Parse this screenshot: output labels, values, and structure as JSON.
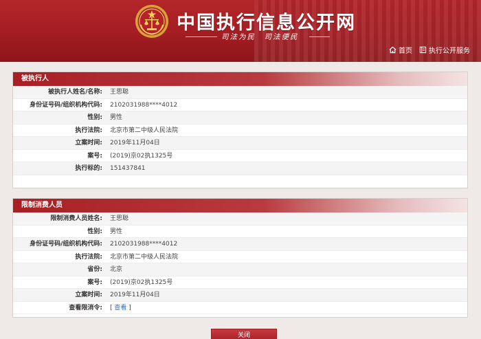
{
  "header": {
    "site_title": "中国执行信息公开网",
    "slogan": "司法为民　司法便民",
    "nav": [
      {
        "label": "首页",
        "icon": "home-icon"
      },
      {
        "label": "执行公开服务",
        "icon": "book-icon"
      }
    ]
  },
  "section1": {
    "title": "被执行人",
    "rows": [
      {
        "label": "被执行人姓名/名称:",
        "value": "王思聪"
      },
      {
        "label": "身份证号码/组织机构代码:",
        "value": "2102031988****4012"
      },
      {
        "label": "性别:",
        "value": "男性"
      },
      {
        "label": "执行法院:",
        "value": "北京市第二中级人民法院"
      },
      {
        "label": "立案时间:",
        "value": "2019年11月04日"
      },
      {
        "label": "案号:",
        "value": "(2019)京02执1325号"
      },
      {
        "label": "执行标的:",
        "value": "151437841"
      }
    ]
  },
  "section2": {
    "title": "限制消费人员",
    "rows": [
      {
        "label": "限制消费人员姓名:",
        "value": "王思聪"
      },
      {
        "label": "性别:",
        "value": "男性"
      },
      {
        "label": "身份证号码/组织机构代码:",
        "value": "2102031988****4012"
      },
      {
        "label": "执行法院:",
        "value": "北京市第二中级人民法院"
      },
      {
        "label": "省份:",
        "value": "北京"
      },
      {
        "label": "案号:",
        "value": "(2019)京02执1325号"
      },
      {
        "label": "立案时间:",
        "value": "2019年11月04日"
      }
    ],
    "order_label": "查看限消令:",
    "order_link_open": "[ ",
    "order_link_text": "查看",
    "order_link_close": " ]"
  },
  "close_label": "关闭",
  "colors": {
    "brand_red": "#a31d22",
    "link_blue": "#3a6db3"
  }
}
